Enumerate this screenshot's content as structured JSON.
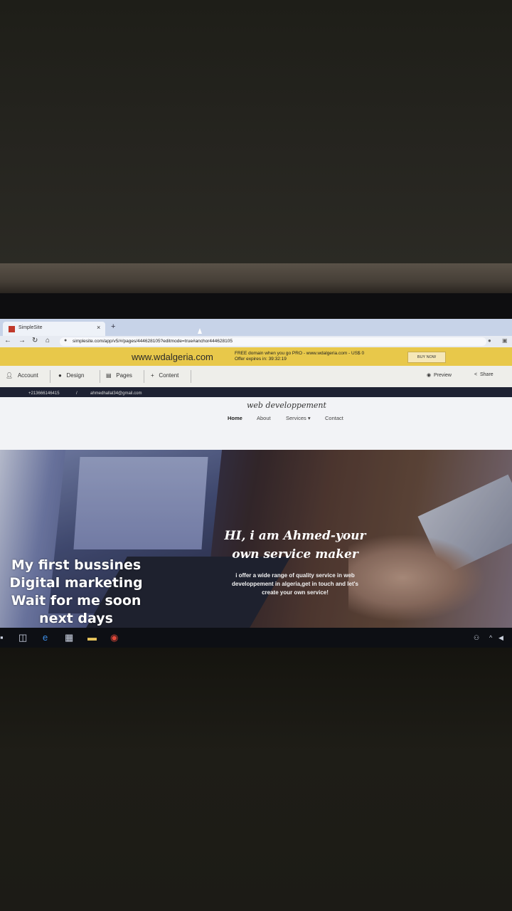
{
  "browser": {
    "tab_title": "SimpleSite",
    "tab_close": "×",
    "new_tab": "+",
    "url": "simplesite.com/app/v5/#/pages/444628105?editmode=true#anchor444628105",
    "icons": [
      "back-icon",
      "forward-icon",
      "reload-icon",
      "home-icon",
      "lock-icon"
    ]
  },
  "promo": {
    "domain": "www.wdalgeria.com",
    "line1": "FREE domain when you go PRO - www.wdalgeria.com - US$ 0",
    "line2": "Offer expires in: 39:32:19",
    "buy_label": "BUY NOW"
  },
  "editor": {
    "items": [
      {
        "icon": "person-icon",
        "label": "Account"
      },
      {
        "icon": "palette-icon",
        "label": "Design"
      },
      {
        "icon": "page-icon",
        "label": "Pages"
      },
      {
        "icon": "plus-icon",
        "label": "Content"
      }
    ],
    "preview_label": "Preview",
    "share_label": "Share"
  },
  "contact": {
    "phone": "+213666146415",
    "separator": "/",
    "email": "ahmedhallal34@gmail.com"
  },
  "site": {
    "logo": "web developpement",
    "nav": [
      "Home",
      "About",
      "Services ▾",
      "Contact"
    ]
  },
  "hero": {
    "title_line1": "HI, i am Ahmed-your",
    "title_line2": "own service maker",
    "subtitle_line1": "i offer a wide range of quality service in web",
    "subtitle_line2": "developpement in algeria,get in touch and let's",
    "subtitle_line3": "create your own service!"
  },
  "overlay_caption": {
    "line1": "My first bussines",
    "line2": "Digital marketing",
    "line3": "Wait for me soon",
    "line4": "next days"
  },
  "taskbar": {
    "icons": [
      "start-icon",
      "task-view-icon",
      "edge-icon",
      "store-icon",
      "file-explorer-icon",
      "chrome-icon"
    ]
  },
  "colors": {
    "promo_bg": "#e8c84a",
    "contact_bar_bg": "#1e2233",
    "tab_bar_bg": "#c7d3e8"
  }
}
